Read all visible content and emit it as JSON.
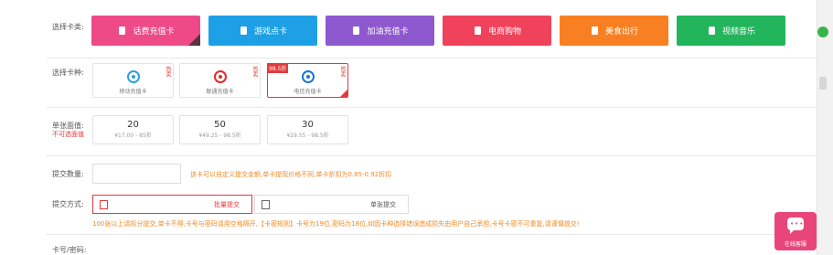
{
  "form": {
    "card_type_label": "选择卡类:",
    "carrier_label": "选择卡种:",
    "amount_label": "单张面值:",
    "amount_sub": "不可选面值",
    "qty_label": "提交数量:",
    "submit_method_label": "提交方式:",
    "card_pwd_label": "卡号/密码:"
  },
  "categories": [
    {
      "label": "话费充值卡",
      "icon": "phone-card-icon",
      "color": "#ee4a88"
    },
    {
      "label": "游戏点卡",
      "icon": "gamepad-icon",
      "color": "#1ea0e6"
    },
    {
      "label": "加油充值卡",
      "icon": "fuel-pump-icon",
      "color": "#8e58cf"
    },
    {
      "label": "电商购物",
      "icon": "shopping-card-icon",
      "color": "#f0425a"
    },
    {
      "label": "美食出行",
      "icon": "fork-knife-icon",
      "color": "#f98022"
    },
    {
      "label": "视频音乐",
      "icon": "video-play-icon",
      "color": "#22b55c"
    }
  ],
  "carriers": [
    {
      "name": "移动充值卡",
      "tag": "热卖",
      "discount": "",
      "icon": "china-mobile-logo",
      "color": "#2aa0dd"
    },
    {
      "name": "联通充值卡",
      "tag": "热卖",
      "discount": "",
      "icon": "china-unicom-logo",
      "color": "#e32a27"
    },
    {
      "name": "电信充值卡",
      "tag": "热卖",
      "discount": "98.5折",
      "icon": "china-telecom-logo",
      "color": "#1976d2"
    }
  ],
  "amounts": [
    {
      "value": "20",
      "price": "¥17.00 - 85折"
    },
    {
      "value": "50",
      "price": "¥49.25 - 98.5折"
    },
    {
      "value": "30",
      "price": "¥29.55 - 98.5折"
    }
  ],
  "qty_note": "该卡可以自定义提交金额,单卡提现价格不同,单卡折扣为0.85-0.92折扣",
  "submit_options": [
    {
      "label": "批量提交",
      "icon": "batch-icon"
    },
    {
      "label": "单张提交",
      "icon": "single-icon"
    }
  ],
  "warning": "100张以上请拆分提交,单卡不得,卡号与密码请用空格隔开,【卡密规则】卡号为19位,密码为18位,如因卡种选择错误造成损失由用户自己承担,卡号卡密不可重复,请谨慎提交!",
  "chat": {
    "label": "在线客服"
  }
}
